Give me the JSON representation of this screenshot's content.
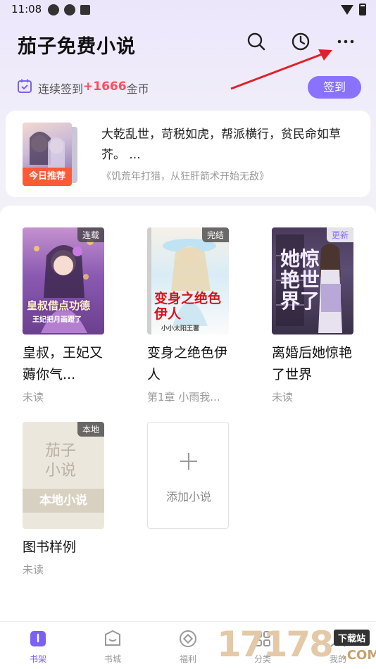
{
  "status_bar": {
    "time": "11:08"
  },
  "header": {
    "title": "茄子免费小说",
    "icons": [
      "search-icon",
      "history-icon",
      "more-icon"
    ]
  },
  "checkin": {
    "prefix": "连续签到",
    "coins": "+1666",
    "suffix": "金币",
    "button": "签到"
  },
  "recommend": {
    "badge": "今日推荐",
    "description": "大乾乱世，苛税如虎，帮派横行，贫民命如草芥。 ...",
    "source": "《饥荒年打猎，从狂肝箭术开始无敌》"
  },
  "shelf": {
    "books": [
      {
        "badge": "连载",
        "title": "皇叔，王妃又薅你气...",
        "sub": "未读",
        "cover_title": "皇叔借点功德",
        "cover_sub": "王妃把月画蹬了"
      },
      {
        "badge": "完结",
        "title": "变身之绝色伊人",
        "sub": "第1章 小雨我...",
        "cover_title": "变身之绝色伊人",
        "cover_sub": "小小太阳王著"
      },
      {
        "badge": "更新",
        "title": "离婚后她惊艳了世界",
        "sub": "未读",
        "cover_title": "她惊艳世界了"
      },
      {
        "badge": "本地",
        "title": "图书样例",
        "sub": "未读",
        "cover_title": "茄子小说",
        "cover_band": "本地小说"
      }
    ],
    "add_label": "添加小说"
  },
  "nav": {
    "items": [
      {
        "label": "书架",
        "icon": "bookshelf-icon",
        "active": true
      },
      {
        "label": "书城",
        "icon": "bookstore-icon"
      },
      {
        "label": "福利",
        "icon": "welfare-icon"
      },
      {
        "label": "分类",
        "icon": "category-icon"
      },
      {
        "label": "我的",
        "icon": "profile-icon"
      }
    ]
  },
  "watermark": {
    "number": "17178",
    "tag": "下载站",
    "domain": ".COM"
  },
  "colors": {
    "accent": "#8a72ff",
    "coin": "#ff4d5e",
    "recommend_badge": "#ff5a36"
  }
}
